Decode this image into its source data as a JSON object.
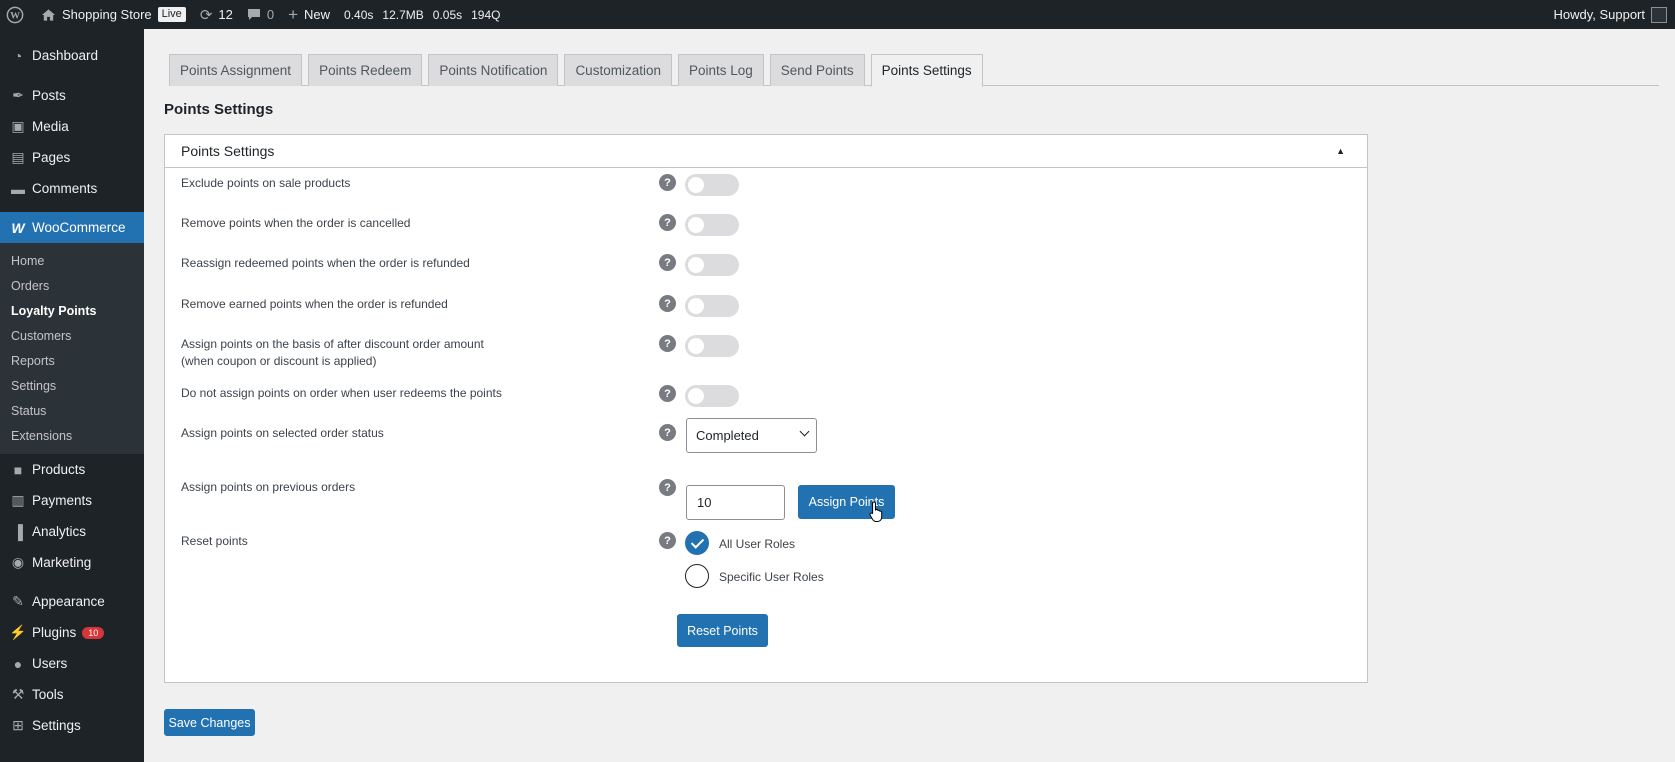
{
  "adminbar": {
    "site_name": "Shopping Store",
    "live_badge": "Live",
    "updates_count": "12",
    "comments_count": "0",
    "new_label": "New",
    "perf": [
      "0.40s",
      "12.7MB",
      "0.05s",
      "194Q"
    ],
    "greeting": "Howdy, Support"
  },
  "sidebar": {
    "items_top": [
      {
        "label": "Dashboard",
        "icon": "dashboard-icon"
      },
      {
        "label": "Posts",
        "icon": "pin-icon"
      },
      {
        "label": "Media",
        "icon": "media-icon"
      },
      {
        "label": "Pages",
        "icon": "pages-icon"
      },
      {
        "label": "Comments",
        "icon": "comment-icon"
      }
    ],
    "woocommerce": "WooCommerce",
    "woo_submenu": [
      "Home",
      "Orders",
      "Loyalty Points",
      "Customers",
      "Reports",
      "Settings",
      "Status",
      "Extensions"
    ],
    "items_bottom": [
      {
        "label": "Products",
        "icon": "archive-icon"
      },
      {
        "label": "Payments",
        "icon": "payments-icon"
      },
      {
        "label": "Analytics",
        "icon": "bar-chart-icon"
      },
      {
        "label": "Marketing",
        "icon": "megaphone-icon"
      },
      {
        "label": "Appearance",
        "icon": "brush-icon"
      },
      {
        "label": "Plugins",
        "icon": "plug-icon",
        "badge": "10"
      },
      {
        "label": "Users",
        "icon": "user-icon"
      },
      {
        "label": "Tools",
        "icon": "wrench-icon"
      },
      {
        "label": "Settings",
        "icon": "settings-icon"
      }
    ]
  },
  "tabs": [
    "Points Assignment",
    "Points Redeem",
    "Points Notification",
    "Customization",
    "Points Log",
    "Send Points",
    "Points Settings"
  ],
  "active_tab": "Points Settings",
  "page_title": "Points Settings",
  "panel": {
    "title": "Points Settings",
    "toggles": [
      {
        "label": "Exclude points on sale products",
        "enabled": false
      },
      {
        "label": "Remove points when the order is cancelled",
        "enabled": false
      },
      {
        "label": "Reassign redeemed points when the order is refunded",
        "enabled": false
      },
      {
        "label": "Remove earned points when the order is refunded",
        "enabled": false
      },
      {
        "label": "Assign points on the basis of after discount order amount",
        "label_line2": "(when coupon or discount is applied)",
        "enabled": false
      },
      {
        "label": "Do not assign points on order when user redeems the points",
        "enabled": false
      }
    ],
    "order_status": {
      "label": "Assign points on selected order status",
      "value": "Completed"
    },
    "previous_orders": {
      "label": "Assign points on previous orders",
      "value": "10",
      "button": "Assign Points"
    },
    "reset": {
      "label": "Reset points",
      "options": [
        {
          "label": "All User Roles",
          "checked": true
        },
        {
          "label": "Specific User Roles",
          "checked": false
        }
      ],
      "button": "Reset Points"
    },
    "help_glyph": "?"
  },
  "save_button": "Save Changes",
  "colors": {
    "accent": "#2271b1",
    "adminbar": "#1d2327",
    "background": "#f0f0f1"
  }
}
